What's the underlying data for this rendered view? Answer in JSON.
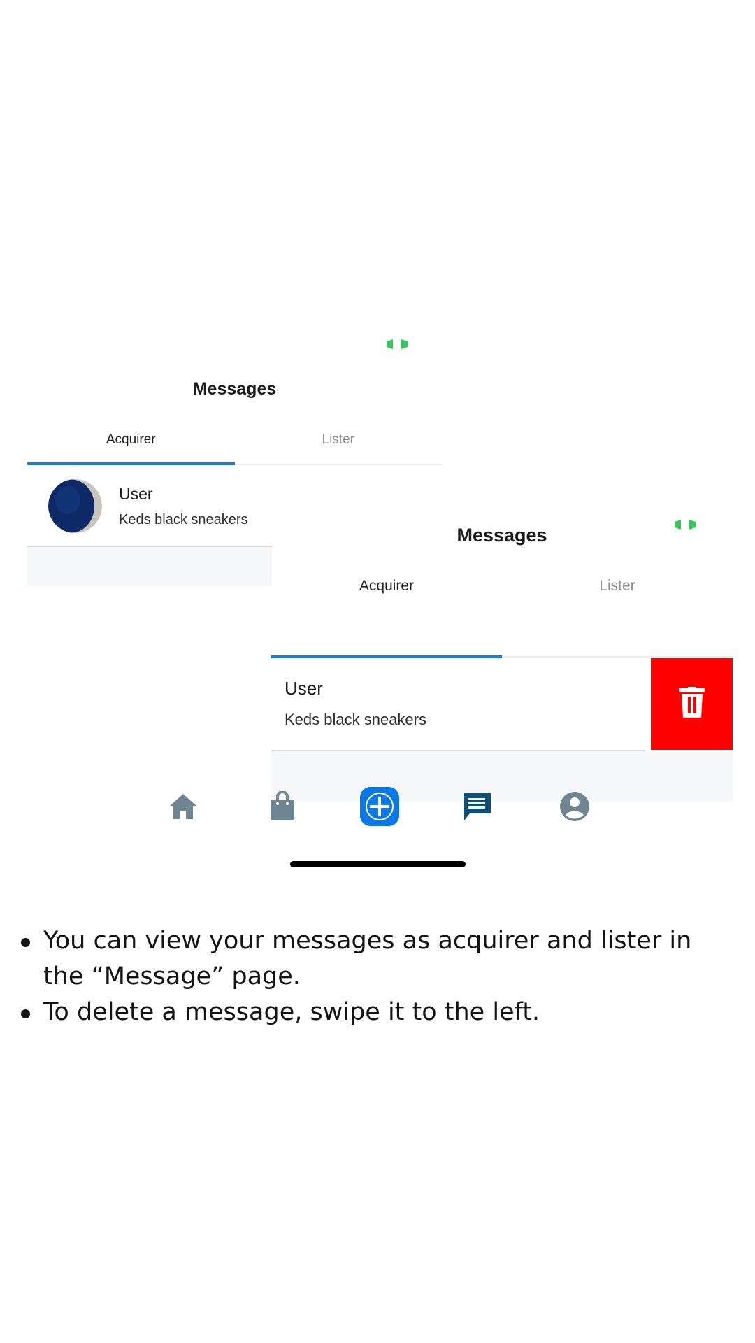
{
  "screen1": {
    "title": "Messages",
    "tabs": [
      {
        "label": "Acquirer",
        "active": true
      },
      {
        "label": "Lister",
        "active": false
      }
    ],
    "conversation": {
      "name": "User",
      "item": "Keds black sneakers",
      "avatar": "sneaker-thumbnail"
    }
  },
  "screen2": {
    "title": "Messages",
    "tabs": [
      {
        "label": "Acquirer",
        "active": true
      },
      {
        "label": "Lister",
        "active": false
      }
    ],
    "conversation": {
      "name": "User",
      "item": "Keds black sneakers"
    },
    "delete_action": {
      "icon": "trash-icon",
      "color": "#ff0000"
    }
  },
  "bottom_nav": {
    "items": [
      {
        "icon": "home-icon",
        "active": false
      },
      {
        "icon": "shopping-bag-icon",
        "active": false
      },
      {
        "icon": "add-icon",
        "active": false
      },
      {
        "icon": "chat-icon",
        "active": true
      },
      {
        "icon": "account-icon",
        "active": false
      }
    ]
  },
  "instructions": {
    "items": [
      "You can view your messages as acquirer and lister in the “Message” page.",
      "To delete a message, swipe it to the left."
    ]
  },
  "colors": {
    "accent": "#1d7dd1",
    "add_button": "#0a79e6",
    "chat_active": "#0f4f73",
    "nav_inactive": "#6f8591",
    "delete": "#ff0000",
    "indicator": "#34c759"
  }
}
